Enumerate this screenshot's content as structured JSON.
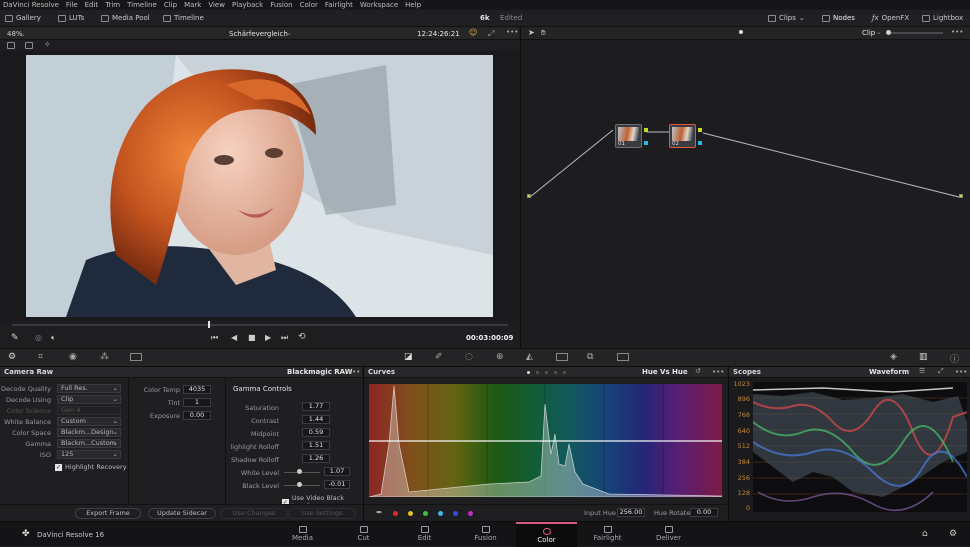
{
  "app": {
    "menu": [
      "DaVinci Resolve",
      "File",
      "Edit",
      "Trim",
      "Timeline",
      "Clip",
      "Mark",
      "View",
      "Playback",
      "Fusion",
      "Color",
      "Fairlight",
      "Workspace",
      "Help"
    ]
  },
  "toolbar": {
    "gallery": "Gallery",
    "luts": "LUTs",
    "media_pool": "Media Pool",
    "timeline": "Timeline",
    "project_res": "6k",
    "project_status": "Edited",
    "clips": "Clips",
    "nodes": "Nodes",
    "openfx": "OpenFX",
    "lightbox": "Lightbox"
  },
  "viewer": {
    "zoom": "48%",
    "clip_name": "Schärfevergleich",
    "timecode": "12:24:26:21",
    "duration": "00:03:00:09"
  },
  "nodegraph": {
    "mode": "Clip",
    "nodes": [
      {
        "label": "01"
      },
      {
        "label": "02"
      }
    ]
  },
  "camera_raw": {
    "title": "Camera Raw",
    "codec": "Blackmagic RAW",
    "left_fields": [
      {
        "label": "Decode Quality",
        "value": "Full Res.",
        "disabled": false
      },
      {
        "label": "Decode Using",
        "value": "Clip",
        "disabled": false
      },
      {
        "label": "Color Science",
        "value": "Gen 4",
        "disabled": true
      },
      {
        "label": "White Balance",
        "value": "Custom",
        "disabled": false
      },
      {
        "label": "Color Space",
        "value": "Blackm...Design",
        "disabled": false
      },
      {
        "label": "Gamma",
        "value": "Blackm...Custom",
        "disabled": false
      },
      {
        "label": "ISO",
        "value": "125",
        "disabled": false
      }
    ],
    "highlight_recovery": "Highlight Recovery",
    "mid_fields": [
      {
        "label": "Color Temp",
        "value": "4035"
      },
      {
        "label": "Tint",
        "value": "1"
      },
      {
        "label": "Exposure",
        "value": "0.00"
      }
    ],
    "gamma_controls": "Gamma Controls",
    "gamma_fields": [
      {
        "label": "Saturation",
        "value": "1.77"
      },
      {
        "label": "Contrast",
        "value": "1.44"
      },
      {
        "label": "Midpoint",
        "value": "0.59"
      },
      {
        "label": "lighlight Rolloff",
        "value": "1.51"
      },
      {
        "label": "Shadow Rolloff",
        "value": "1.26"
      }
    ],
    "white_level": {
      "label": "White Level",
      "value": "1.07"
    },
    "black_level": {
      "label": "Black Level",
      "value": "-0.01"
    },
    "use_video_black": "Use Video Black Level",
    "buttons": {
      "export_frame": "Export Frame",
      "update_sidecar": "Update Sidecar",
      "use_changes": "Use Changes",
      "use_settings": "Use Settings"
    }
  },
  "curves": {
    "title": "Curves",
    "mode": "Hue Vs Hue",
    "input_hue_label": "Input Hue",
    "input_hue_value": "256.00",
    "hue_rotate_label": "Hue Rotate",
    "hue_rotate_value": "0.00",
    "dot_colors": [
      "#e02b2b",
      "#e5c21d",
      "#3fbf3f",
      "#3fb6e6",
      "#3050e0",
      "#c02fc0"
    ]
  },
  "scopes": {
    "title": "Scopes",
    "mode": "Waveform",
    "ticks": [
      "1023",
      "896",
      "768",
      "640",
      "512",
      "384",
      "256",
      "128",
      "0"
    ]
  },
  "pages": {
    "brand": "DaVinci Resolve 16",
    "items": [
      {
        "label": "Media",
        "active": false
      },
      {
        "label": "Cut",
        "active": false
      },
      {
        "label": "Edit",
        "active": false
      },
      {
        "label": "Fusion",
        "active": false
      },
      {
        "label": "Color",
        "active": true
      },
      {
        "label": "Fairlight",
        "active": false
      },
      {
        "label": "Deliver",
        "active": false
      }
    ]
  },
  "colors": {
    "accent": "#e05a3a",
    "active_page": "#d45b8a",
    "scope_tick": "#c28833"
  }
}
